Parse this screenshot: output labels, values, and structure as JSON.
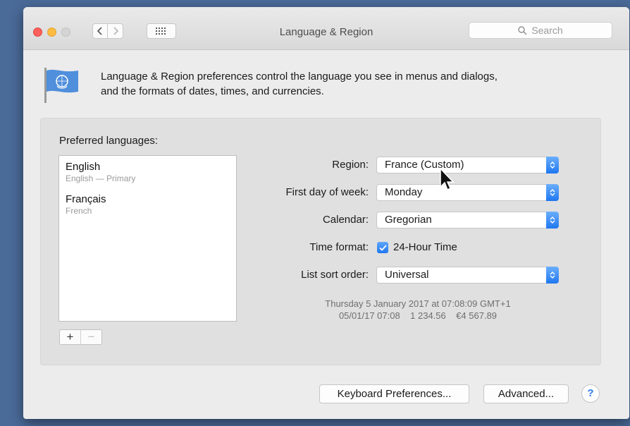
{
  "window": {
    "title": "Language & Region",
    "search_placeholder": "Search"
  },
  "description": {
    "line1": "Language & Region preferences control the language you see in menus and dialogs,",
    "line2": "and the formats of dates, times, and currencies."
  },
  "preferred_languages": {
    "label": "Preferred languages:",
    "items": [
      {
        "name": "English",
        "detail": "English — Primary"
      },
      {
        "name": "Français",
        "detail": "French"
      }
    ],
    "add_label": "+",
    "remove_label": "−"
  },
  "settings": {
    "region": {
      "label": "Region:",
      "value": "France (Custom)"
    },
    "first_day": {
      "label": "First day of week:",
      "value": "Monday"
    },
    "calendar": {
      "label": "Calendar:",
      "value": "Gregorian"
    },
    "time_format": {
      "label": "Time format:",
      "checkbox_label": "24-Hour Time",
      "checked": true
    },
    "sort_order": {
      "label": "List sort order:",
      "value": "Universal"
    }
  },
  "sample": {
    "line1": "Thursday 5 January 2017 at 07:08:09 GMT+1",
    "line2": "05/01/17 07:08    1 234.56    €4 567.89"
  },
  "buttons": {
    "keyboard": "Keyboard Preferences...",
    "advanced": "Advanced...",
    "help": "?"
  },
  "colors": {
    "accent": "#1f77f0",
    "desktop": "#4a6a98"
  }
}
